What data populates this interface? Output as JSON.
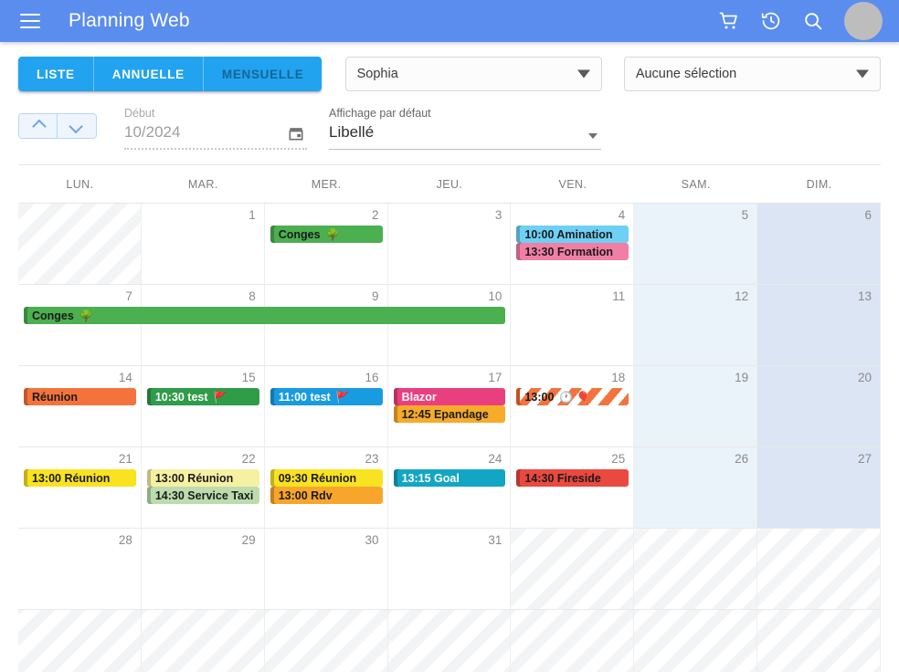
{
  "appbar": {
    "title": "Planning Web",
    "menu_icon": "hamburger-menu-icon",
    "icons": [
      "cart-icon",
      "history-icon",
      "search-icon"
    ],
    "avatar": "user-avatar",
    "bg": "#5b8def"
  },
  "toolbar": {
    "view_tabs": [
      {
        "label": "LISTE",
        "active": false
      },
      {
        "label": "ANNUELLE",
        "active": false
      },
      {
        "label": "MENSUELLE",
        "active": true
      }
    ],
    "person_select": {
      "value": "Sophia"
    },
    "resource_select": {
      "value": "Aucune sélection"
    },
    "stepper": {
      "up": "chevron-up-icon",
      "down": "chevron-down-icon"
    },
    "start_field": {
      "label": "Début",
      "value": "10/2024",
      "icon": "calendar-icon"
    },
    "display_field": {
      "label": "Affichage par défaut",
      "value": "Libellé"
    },
    "accent": "#22a3f0"
  },
  "calendar": {
    "day_headers": [
      "LUN.",
      "MAR.",
      "MER.",
      "JEU.",
      "VEN.",
      "SAM.",
      "DIM."
    ],
    "weeks": [
      {
        "days": [
          {
            "num": "",
            "kind": "off"
          },
          {
            "num": "1",
            "kind": "normal"
          },
          {
            "num": "2",
            "kind": "normal"
          },
          {
            "num": "3",
            "kind": "normal"
          },
          {
            "num": "4",
            "kind": "normal"
          },
          {
            "num": "5",
            "kind": "sat"
          },
          {
            "num": "6",
            "kind": "sun"
          }
        ],
        "events": [
          {
            "label": "Conges",
            "emoji": "🌳",
            "col": 2,
            "span": 1,
            "row": 0,
            "bg": "#4caf50",
            "text": "dark"
          },
          {
            "label": "10:00 Amination",
            "emoji": "",
            "col": 4,
            "span": 1,
            "row": 0,
            "bg": "#6ed0f5",
            "text": "dark"
          },
          {
            "label": "13:30 Formation",
            "emoji": "",
            "col": 4,
            "span": 1,
            "row": 1,
            "bg": "#f17fa5",
            "text": "dark"
          }
        ]
      },
      {
        "days": [
          {
            "num": "7",
            "kind": "normal"
          },
          {
            "num": "8",
            "kind": "normal"
          },
          {
            "num": "9",
            "kind": "normal"
          },
          {
            "num": "10",
            "kind": "normal"
          },
          {
            "num": "11",
            "kind": "normal"
          },
          {
            "num": "12",
            "kind": "sat"
          },
          {
            "num": "13",
            "kind": "sun"
          }
        ],
        "events": [
          {
            "label": "Conges",
            "emoji": "🌳",
            "col": 0,
            "span": 4,
            "row": 0,
            "bg": "#4caf50",
            "text": "dark"
          }
        ]
      },
      {
        "days": [
          {
            "num": "14",
            "kind": "normal"
          },
          {
            "num": "15",
            "kind": "normal"
          },
          {
            "num": "16",
            "kind": "normal"
          },
          {
            "num": "17",
            "kind": "normal"
          },
          {
            "num": "18",
            "kind": "normal"
          },
          {
            "num": "19",
            "kind": "sat"
          },
          {
            "num": "20",
            "kind": "sun"
          }
        ],
        "events": [
          {
            "label": "Réunion",
            "emoji": "",
            "col": 0,
            "span": 1,
            "row": 0,
            "bg": "#f4733c",
            "text": "dark"
          },
          {
            "label": "10:30 test",
            "emoji": "🚩",
            "col": 1,
            "span": 1,
            "row": 0,
            "bg": "#2e9c48",
            "text": "white"
          },
          {
            "label": "11:00 test",
            "emoji": "🚩",
            "col": 2,
            "span": 1,
            "row": 0,
            "bg": "#199be0",
            "text": "white"
          },
          {
            "label": "Blazor",
            "emoji": "",
            "col": 3,
            "span": 1,
            "row": 0,
            "bg": "#ea3f7e",
            "text": "white"
          },
          {
            "label": "12:45 Epandage",
            "emoji": "",
            "col": 3,
            "span": 1,
            "row": 1,
            "bg": "#f6ab2a",
            "text": "dark"
          },
          {
            "label": "13:00",
            "emoji": "🕐 🎈",
            "col": 4,
            "span": 1,
            "row": 0,
            "bg": "striped",
            "text": "dark"
          }
        ]
      },
      {
        "days": [
          {
            "num": "21",
            "kind": "normal"
          },
          {
            "num": "22",
            "kind": "normal"
          },
          {
            "num": "23",
            "kind": "normal"
          },
          {
            "num": "24",
            "kind": "normal"
          },
          {
            "num": "25",
            "kind": "normal"
          },
          {
            "num": "26",
            "kind": "sat"
          },
          {
            "num": "27",
            "kind": "sun"
          }
        ],
        "events": [
          {
            "label": "13:00 Réunion",
            "emoji": "",
            "col": 0,
            "span": 1,
            "row": 0,
            "bg": "#f9e220",
            "text": "dark"
          },
          {
            "label": "13:00 Réunion",
            "emoji": "",
            "col": 1,
            "span": 1,
            "row": 0,
            "bg": "#f6f0a3",
            "text": "dark"
          },
          {
            "label": "14:30 Service Taxi",
            "emoji": "",
            "col": 1,
            "span": 1,
            "row": 1,
            "bg": "#bcdcae",
            "text": "dark"
          },
          {
            "label": "09:30 Réunion",
            "emoji": "",
            "col": 2,
            "span": 1,
            "row": 0,
            "bg": "#f9e220",
            "text": "dark"
          },
          {
            "label": "13:00 Rdv",
            "emoji": "",
            "col": 2,
            "span": 1,
            "row": 1,
            "bg": "#f7a62b",
            "text": "dark"
          },
          {
            "label": "13:15 Goal",
            "emoji": "",
            "col": 3,
            "span": 1,
            "row": 0,
            "bg": "#13a6c4",
            "text": "white"
          },
          {
            "label": "14:30 Fireside",
            "emoji": "",
            "col": 4,
            "span": 1,
            "row": 0,
            "bg": "#eb4840",
            "text": "dark"
          }
        ]
      },
      {
        "days": [
          {
            "num": "28",
            "kind": "normal"
          },
          {
            "num": "29",
            "kind": "normal"
          },
          {
            "num": "30",
            "kind": "normal"
          },
          {
            "num": "31",
            "kind": "normal"
          },
          {
            "num": "",
            "kind": "off"
          },
          {
            "num": "",
            "kind": "off"
          },
          {
            "num": "",
            "kind": "off"
          }
        ],
        "events": []
      },
      {
        "days": [
          {
            "num": "",
            "kind": "off"
          },
          {
            "num": "",
            "kind": "off"
          },
          {
            "num": "",
            "kind": "off"
          },
          {
            "num": "",
            "kind": "off"
          },
          {
            "num": "",
            "kind": "off"
          },
          {
            "num": "",
            "kind": "off"
          },
          {
            "num": "",
            "kind": "off"
          }
        ],
        "events": []
      }
    ]
  }
}
